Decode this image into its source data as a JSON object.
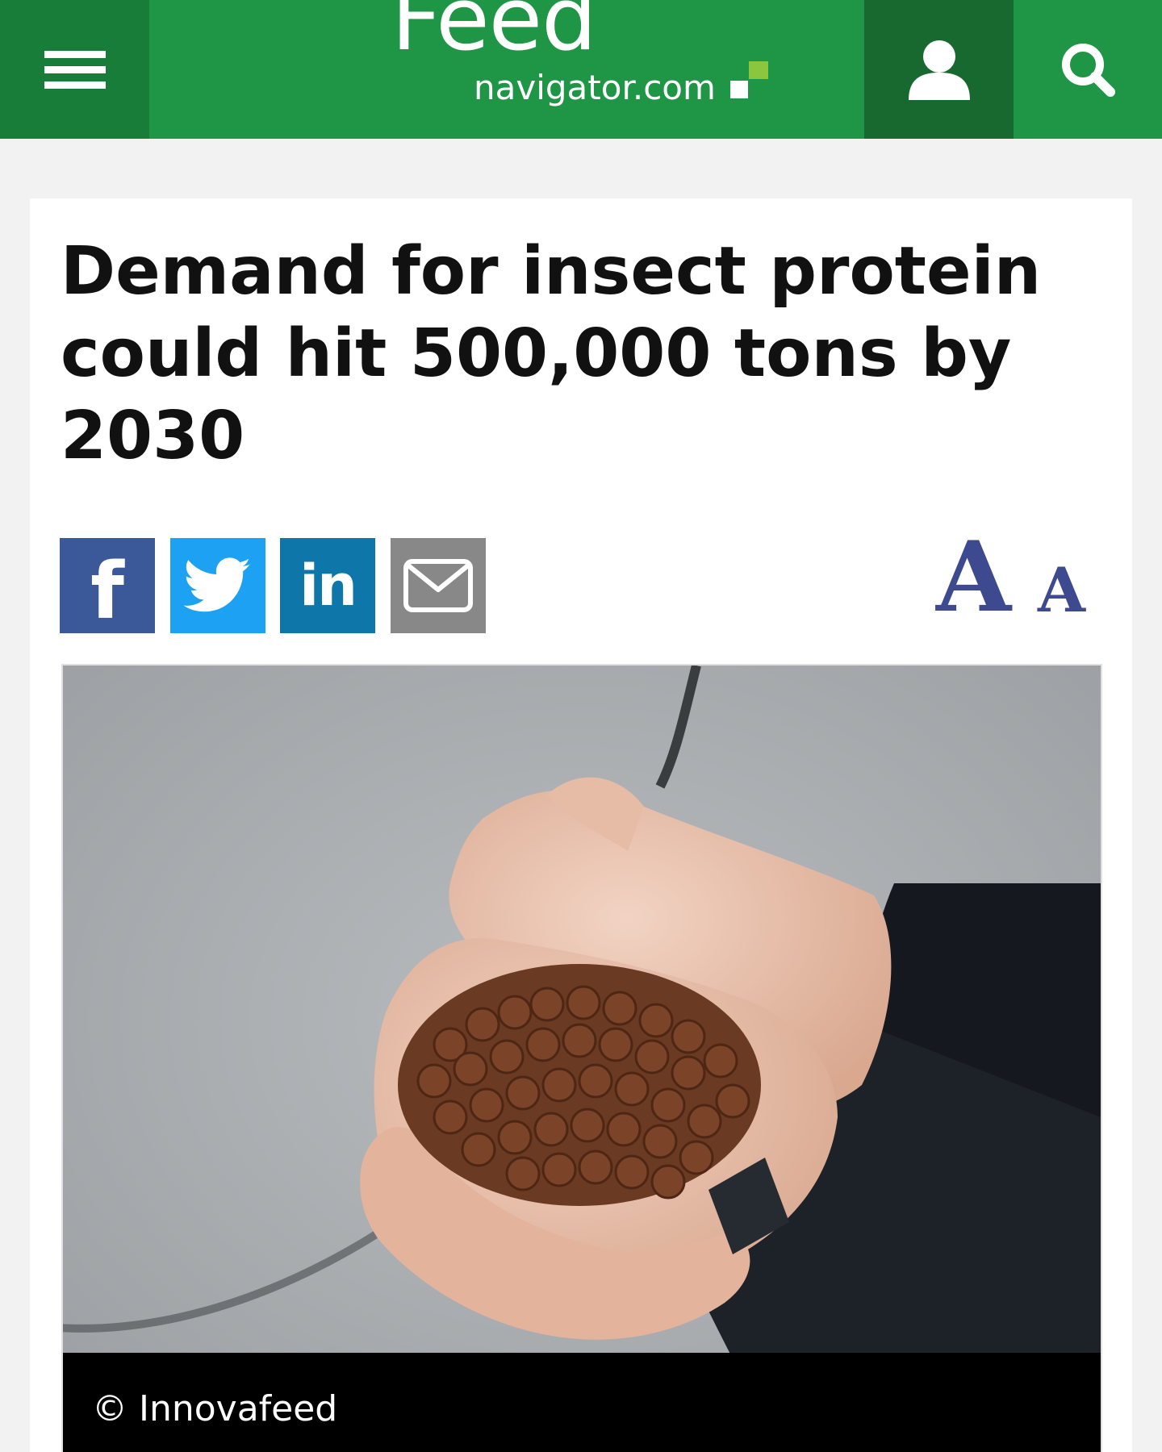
{
  "header": {
    "logo_feed": "Feed",
    "logo_domain": "navigator.com",
    "icons": {
      "menu": "hamburger-menu-icon",
      "user": "user-icon",
      "search": "search-icon"
    },
    "colors": {
      "brand_green": "#1e9646",
      "menu_bg": "#197d3a",
      "user_bg": "#18692f",
      "logo_accent": "#8cc63f"
    }
  },
  "article": {
    "headline": "Demand for insect protein could hit 500,000 tons by 2030",
    "share": {
      "facebook_glyph": "f",
      "linkedin_glyph": "in",
      "icons": [
        "facebook-icon",
        "twitter-icon",
        "linkedin-icon",
        "email-icon"
      ],
      "colors": {
        "facebook": "#3b5998",
        "twitter": "#1da1f2",
        "linkedin": "#0e76a8",
        "email": "#888888"
      }
    },
    "font_size_controls": {
      "large_label": "A",
      "small_label": "A",
      "color": "#3d4a8f"
    },
    "image": {
      "caption": "© Innovafeed"
    }
  }
}
